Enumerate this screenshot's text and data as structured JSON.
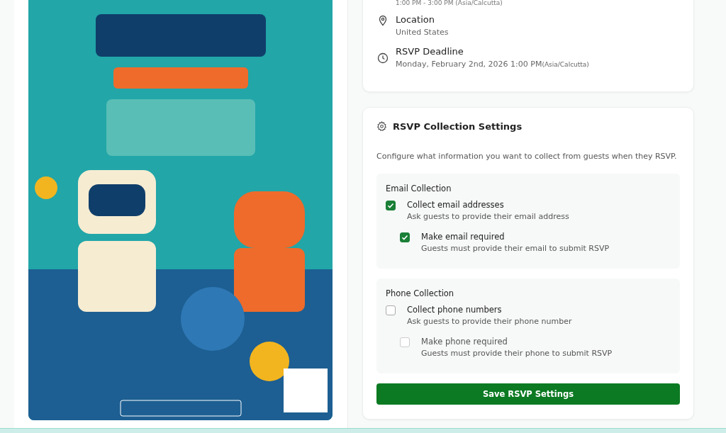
{
  "event_details": {
    "time": "1:00 PM - 3:00 PM (Asia/Calcutta)",
    "items": [
      {
        "kind": "location",
        "label": "Location",
        "value": "United States"
      },
      {
        "kind": "deadline",
        "label": "RSVP Deadline",
        "value": "Monday, February 2nd, 2026 1:00 PM",
        "note": "(Asia/Calcutta)"
      }
    ]
  },
  "rsvp_settings": {
    "title": "RSVP Collection Settings",
    "description": "Configure what information you want to collect from guests when they RSVP.",
    "groups": [
      {
        "title": "Email Collection",
        "options": [
          {
            "label": "Collect email addresses",
            "hint": "Ask guests to provide their email address",
            "checked": true,
            "disabled": false,
            "nested": false
          },
          {
            "label": "Make email required",
            "hint": "Guests must provide their email to submit RSVP",
            "checked": true,
            "disabled": false,
            "nested": true
          }
        ]
      },
      {
        "title": "Phone Collection",
        "options": [
          {
            "label": "Collect phone numbers",
            "hint": "Ask guests to provide their phone number",
            "checked": false,
            "disabled": false,
            "nested": false
          },
          {
            "label": "Make phone required",
            "hint": "Guests must provide their phone to submit RSVP",
            "checked": false,
            "disabled": true,
            "nested": true
          }
        ]
      }
    ],
    "save_button": "Save RSVP Settings"
  }
}
